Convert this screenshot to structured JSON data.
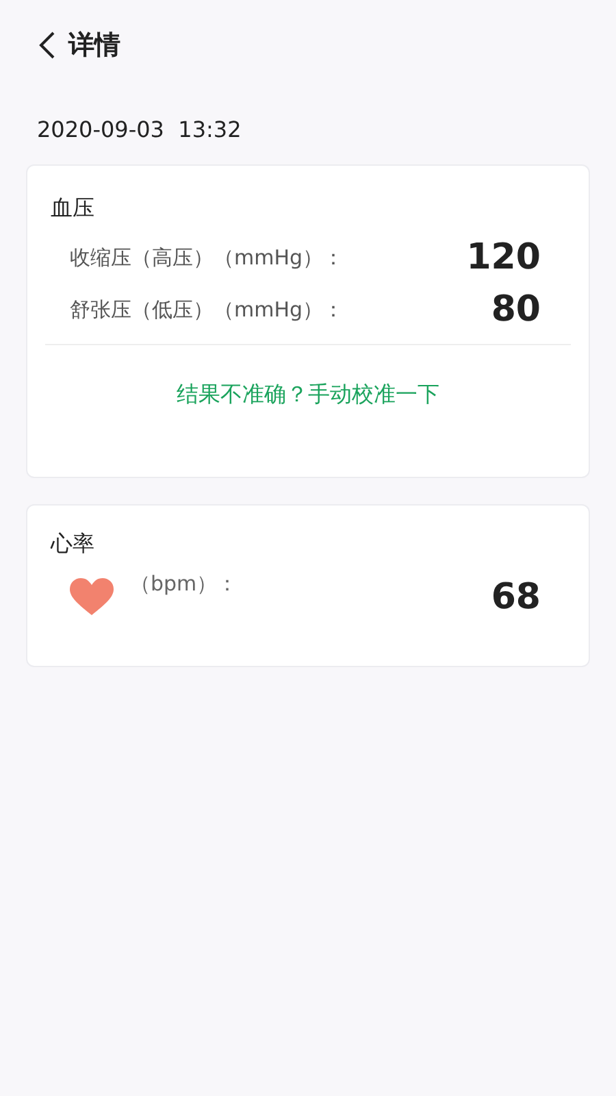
{
  "header": {
    "title": "详情"
  },
  "datetime": "2020-09-03  13:32",
  "blood_pressure": {
    "title": "血压",
    "rows": [
      {
        "label": "收缩压（高压）（mmHg）：",
        "value": "120"
      },
      {
        "label": "舒张压（低压）（mmHg）：",
        "value": "80"
      }
    ],
    "link": "结果不准确？手动校准一下"
  },
  "heart_rate": {
    "title": "心率",
    "label": "（bpm）：",
    "value": "68"
  }
}
